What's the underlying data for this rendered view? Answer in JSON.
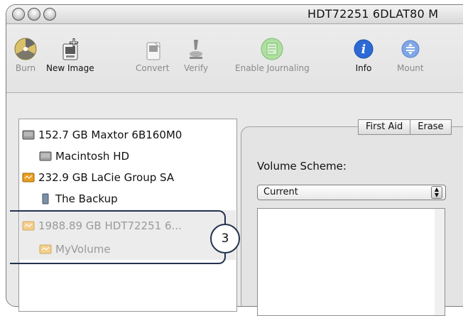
{
  "window": {
    "title": "HDT72251 6DLAT80 M"
  },
  "toolbar": {
    "items": [
      {
        "label": "Burn",
        "icon": "burn-icon",
        "enabled": false
      },
      {
        "label": "New Image",
        "icon": "new-image-icon",
        "enabled": true
      },
      {
        "label": "Convert",
        "icon": "convert-icon",
        "enabled": false
      },
      {
        "label": "Verify",
        "icon": "verify-icon",
        "enabled": false
      },
      {
        "label": "Enable Journaling",
        "icon": "journaling-icon",
        "enabled": false
      },
      {
        "label": "Info",
        "icon": "info-icon",
        "enabled": true
      },
      {
        "label": "Mount",
        "icon": "mount-icon",
        "enabled": false
      }
    ]
  },
  "sidebar": {
    "items": [
      {
        "label": "152.7 GB Maxtor 6B160M0",
        "icon": "hard-drive-icon",
        "level": 0,
        "dim": false
      },
      {
        "label": "Macintosh HD",
        "icon": "volume-icon",
        "level": 1,
        "dim": false
      },
      {
        "label": "232.9 GB LaCie Group SA",
        "icon": "external-drive-icon",
        "level": 0,
        "dim": false
      },
      {
        "label": "The Backup",
        "icon": "volume-icon",
        "level": 1,
        "dim": false
      },
      {
        "label": "1988.89 GB HDT72251 6...",
        "icon": "external-drive-icon",
        "level": 0,
        "dim": true
      },
      {
        "label": "MyVolume",
        "icon": "volume-icon",
        "level": 1,
        "dim": true
      }
    ]
  },
  "callout": {
    "number": "3"
  },
  "tabs": [
    {
      "label": "First Aid"
    },
    {
      "label": "Erase"
    }
  ],
  "partition": {
    "scheme_label": "Volume Scheme:",
    "scheme_value": "Current"
  },
  "colors": {
    "callout_stroke": "#24324f",
    "info_blue": "#2d6ad6",
    "drive_orange": "#e9a020"
  }
}
